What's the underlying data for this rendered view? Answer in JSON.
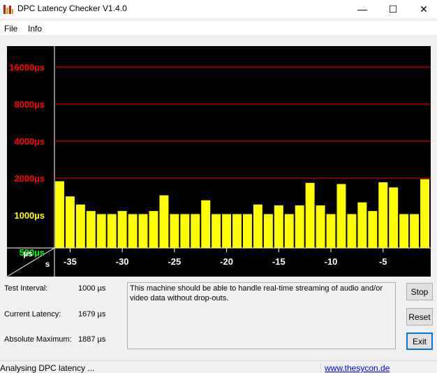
{
  "window": {
    "title": "DPC Latency Checker V1.4.0",
    "minimize_glyph": "—",
    "maximize_glyph": "☐",
    "close_glyph": "✕"
  },
  "menu": {
    "items": [
      "File",
      "Info"
    ]
  },
  "chart_data": {
    "type": "bar",
    "y_ticks": [
      {
        "label": "16000µs",
        "value": 16000,
        "color": "#ff0000",
        "gridline": true
      },
      {
        "label": "8000µs",
        "value": 8000,
        "color": "#ff0000",
        "gridline": true
      },
      {
        "label": "4000µs",
        "value": 4000,
        "color": "#ff0000",
        "gridline": true
      },
      {
        "label": "2000µs",
        "value": 2000,
        "color": "#ff0000",
        "gridline": true
      },
      {
        "label": "1000µs",
        "value": 1000,
        "color": "#ffff00",
        "gridline": false
      },
      {
        "label": "500µs",
        "value": 500,
        "color": "#00ff00",
        "gridline": false
      }
    ],
    "x_ticks": [
      "-35",
      "-30",
      "-25",
      "-20",
      "-15",
      "-10",
      "-5"
    ],
    "x_tick_values": [
      -35,
      -30,
      -25,
      -20,
      -15,
      -10,
      -5
    ],
    "x": [
      -36,
      -35,
      -34,
      -33,
      -32,
      -31,
      -30,
      -29,
      -28,
      -27,
      -26,
      -25,
      -24,
      -23,
      -22,
      -21,
      -20,
      -19,
      -18,
      -17,
      -16,
      -15,
      -14,
      -13,
      -12,
      -11,
      -10,
      -9,
      -8,
      -7,
      -6,
      -5,
      -4,
      -3,
      -2,
      -1
    ],
    "values": [
      1887,
      1420,
      1220,
      1080,
      1020,
      1020,
      1080,
      1020,
      1020,
      1080,
      1450,
      1020,
      1020,
      1020,
      1320,
      1020,
      1020,
      1020,
      1020,
      1220,
      1020,
      1200,
      1020,
      1200,
      1830,
      1200,
      1020,
      1790,
      1020,
      1270,
      1080,
      1850,
      1680,
      1020,
      1020,
      1960
    ],
    "unit_axis_label": "µs",
    "seconds_axis_label": "s",
    "bar_color": "#ffff00",
    "background": "#000000",
    "grid_color": "#ff0000",
    "y_scale": "log2"
  },
  "fields": {
    "test_interval": {
      "label": "Test Interval:",
      "value": "1000 µs"
    },
    "current_latency": {
      "label": "Current Latency:",
      "value": "1679 µs"
    },
    "absolute_maximum": {
      "label": "Absolute Maximum:",
      "value": "1887 µs"
    }
  },
  "message": "This machine should be able to handle real-time streaming of audio and/or video data without drop-outs.",
  "buttons": {
    "stop": "Stop",
    "reset": "Reset",
    "exit": "Exit"
  },
  "status": {
    "text": "Analysing DPC latency ...",
    "link": "www.thesycon.de"
  }
}
